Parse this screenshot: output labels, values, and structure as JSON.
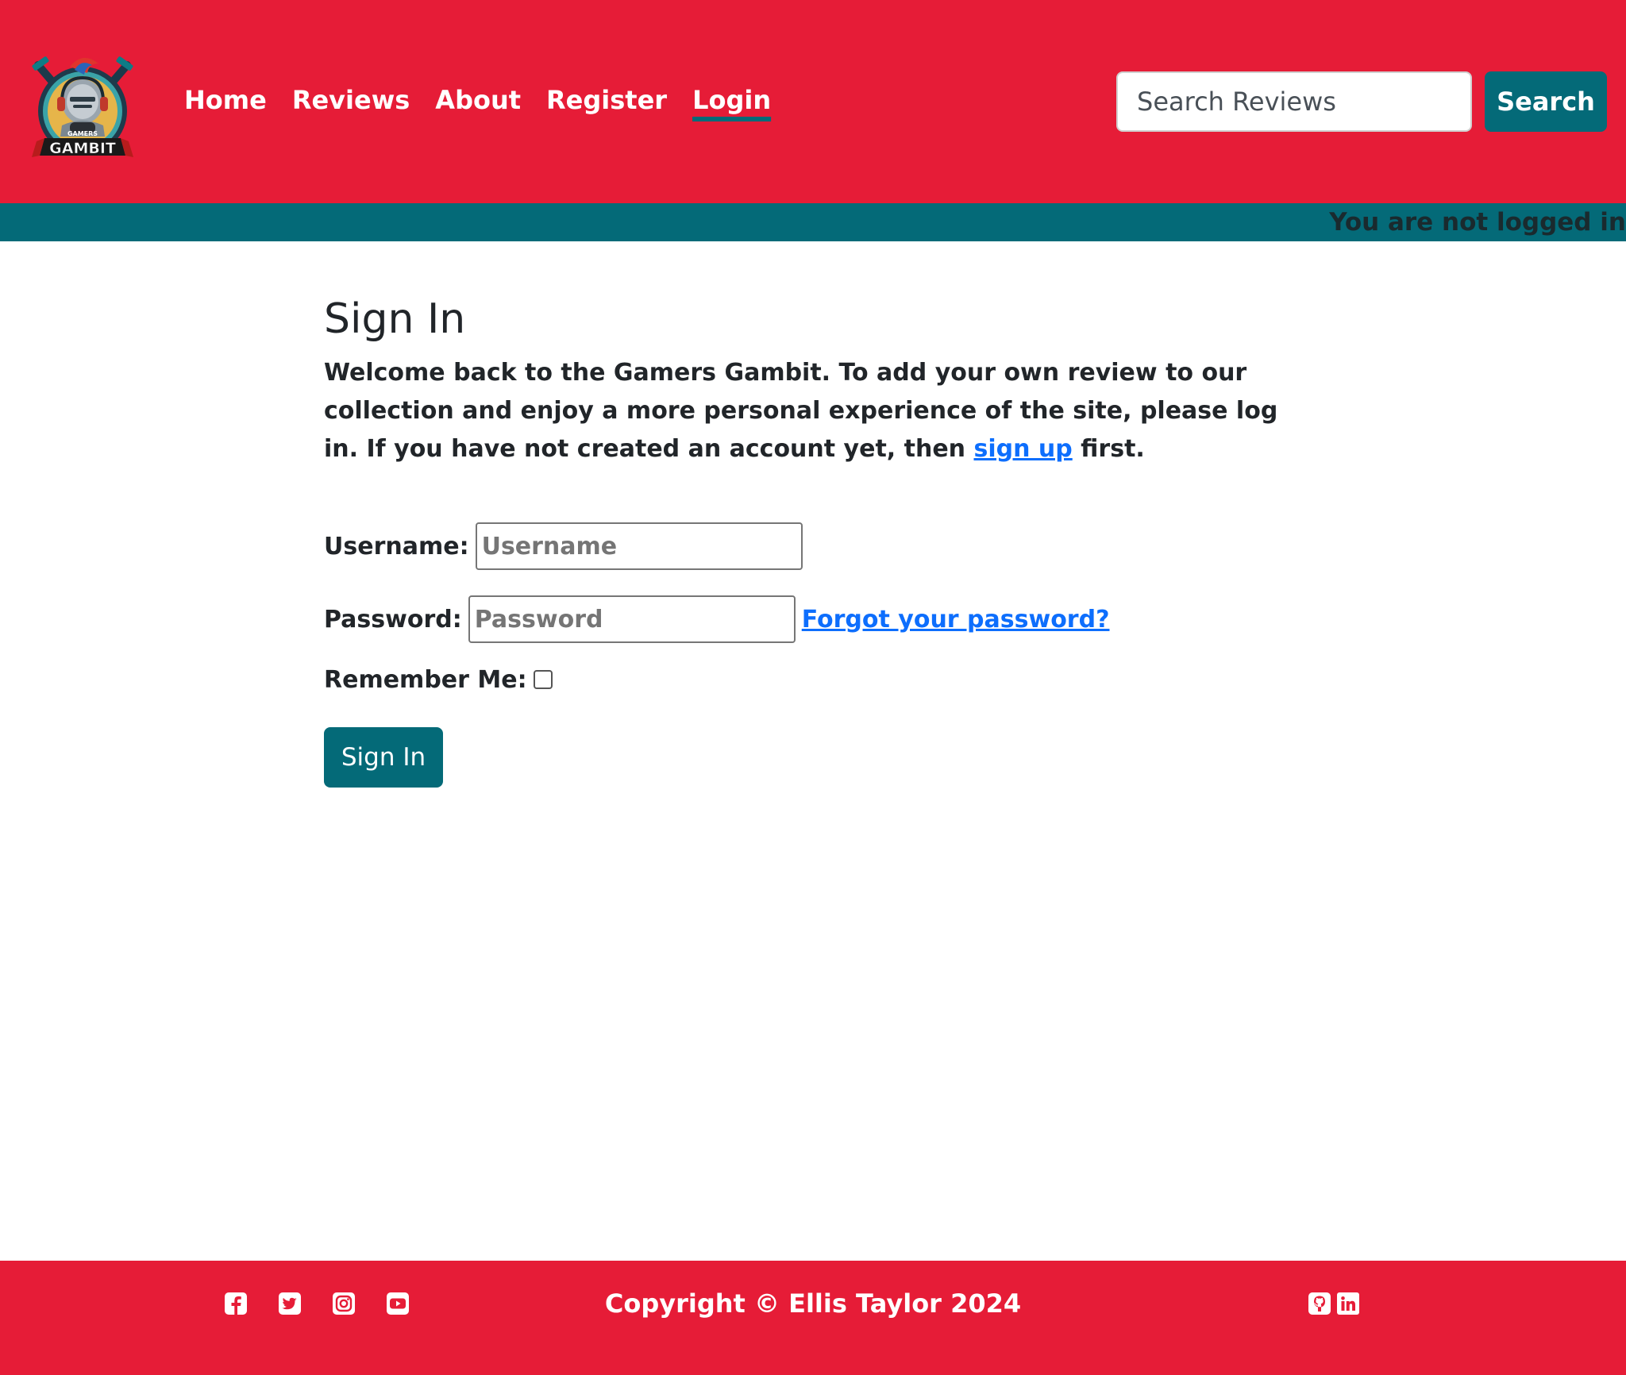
{
  "colors": {
    "brand_red": "#e61c37",
    "brand_teal": "#046a78",
    "link_blue": "#0d6efd"
  },
  "header": {
    "logo": {
      "top_text": "GAMERS",
      "main_text": "GAMBIT"
    },
    "nav": [
      {
        "label": "Home",
        "active": false
      },
      {
        "label": "Reviews",
        "active": false
      },
      {
        "label": "About",
        "active": false
      },
      {
        "label": "Register",
        "active": false
      },
      {
        "label": "Login",
        "active": true
      }
    ],
    "search": {
      "placeholder": "Search Reviews",
      "value": "",
      "button_label": "Search"
    }
  },
  "status_bar": {
    "text": "You are not logged in"
  },
  "main": {
    "title": "Sign In",
    "intro_before": "Welcome back to the Gamers Gambit. To add your own review to our collection and enjoy a more personal experience of the site, please log in. If you have not created an account yet, then ",
    "intro_link": "sign up",
    "intro_after": " first.",
    "form": {
      "username_label": "Username:",
      "username_placeholder": "Username",
      "password_label": "Password:",
      "password_placeholder": "Password",
      "forgot_link": "Forgot your password?",
      "remember_label": "Remember Me:",
      "remember_checked": false,
      "submit_label": "Sign In"
    }
  },
  "footer": {
    "copyright": "Copyright © Ellis Taylor 2024",
    "social_left": [
      "facebook-icon",
      "twitter-icon",
      "instagram-icon",
      "youtube-icon"
    ],
    "social_right": [
      "github-icon",
      "linkedin-icon"
    ]
  }
}
